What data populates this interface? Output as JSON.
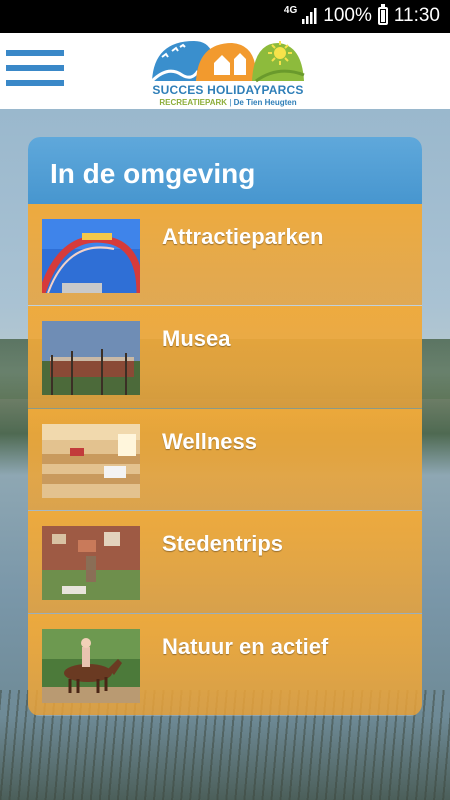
{
  "status_bar": {
    "network": "4G",
    "battery": "100%",
    "time": "11:30"
  },
  "logo": {
    "brand": "SUCCES HOLIDAYPARCS",
    "sub_left": "RECREATIEPARK",
    "sub_right": "De Tien Heugten"
  },
  "card": {
    "title": "In de omgeving",
    "items": [
      {
        "label": "Attractieparken",
        "icon": "rollercoaster-photo"
      },
      {
        "label": "Musea",
        "icon": "museum-photo"
      },
      {
        "label": "Wellness",
        "icon": "sauna-photo"
      },
      {
        "label": "Stedentrips",
        "icon": "city-photo"
      },
      {
        "label": "Natuur en actief",
        "icon": "horse-riding-photo"
      }
    ]
  },
  "colors": {
    "header_blue": "#4796cf",
    "row_orange": "#f0aa3a",
    "menu_blue": "#3a88c8"
  }
}
